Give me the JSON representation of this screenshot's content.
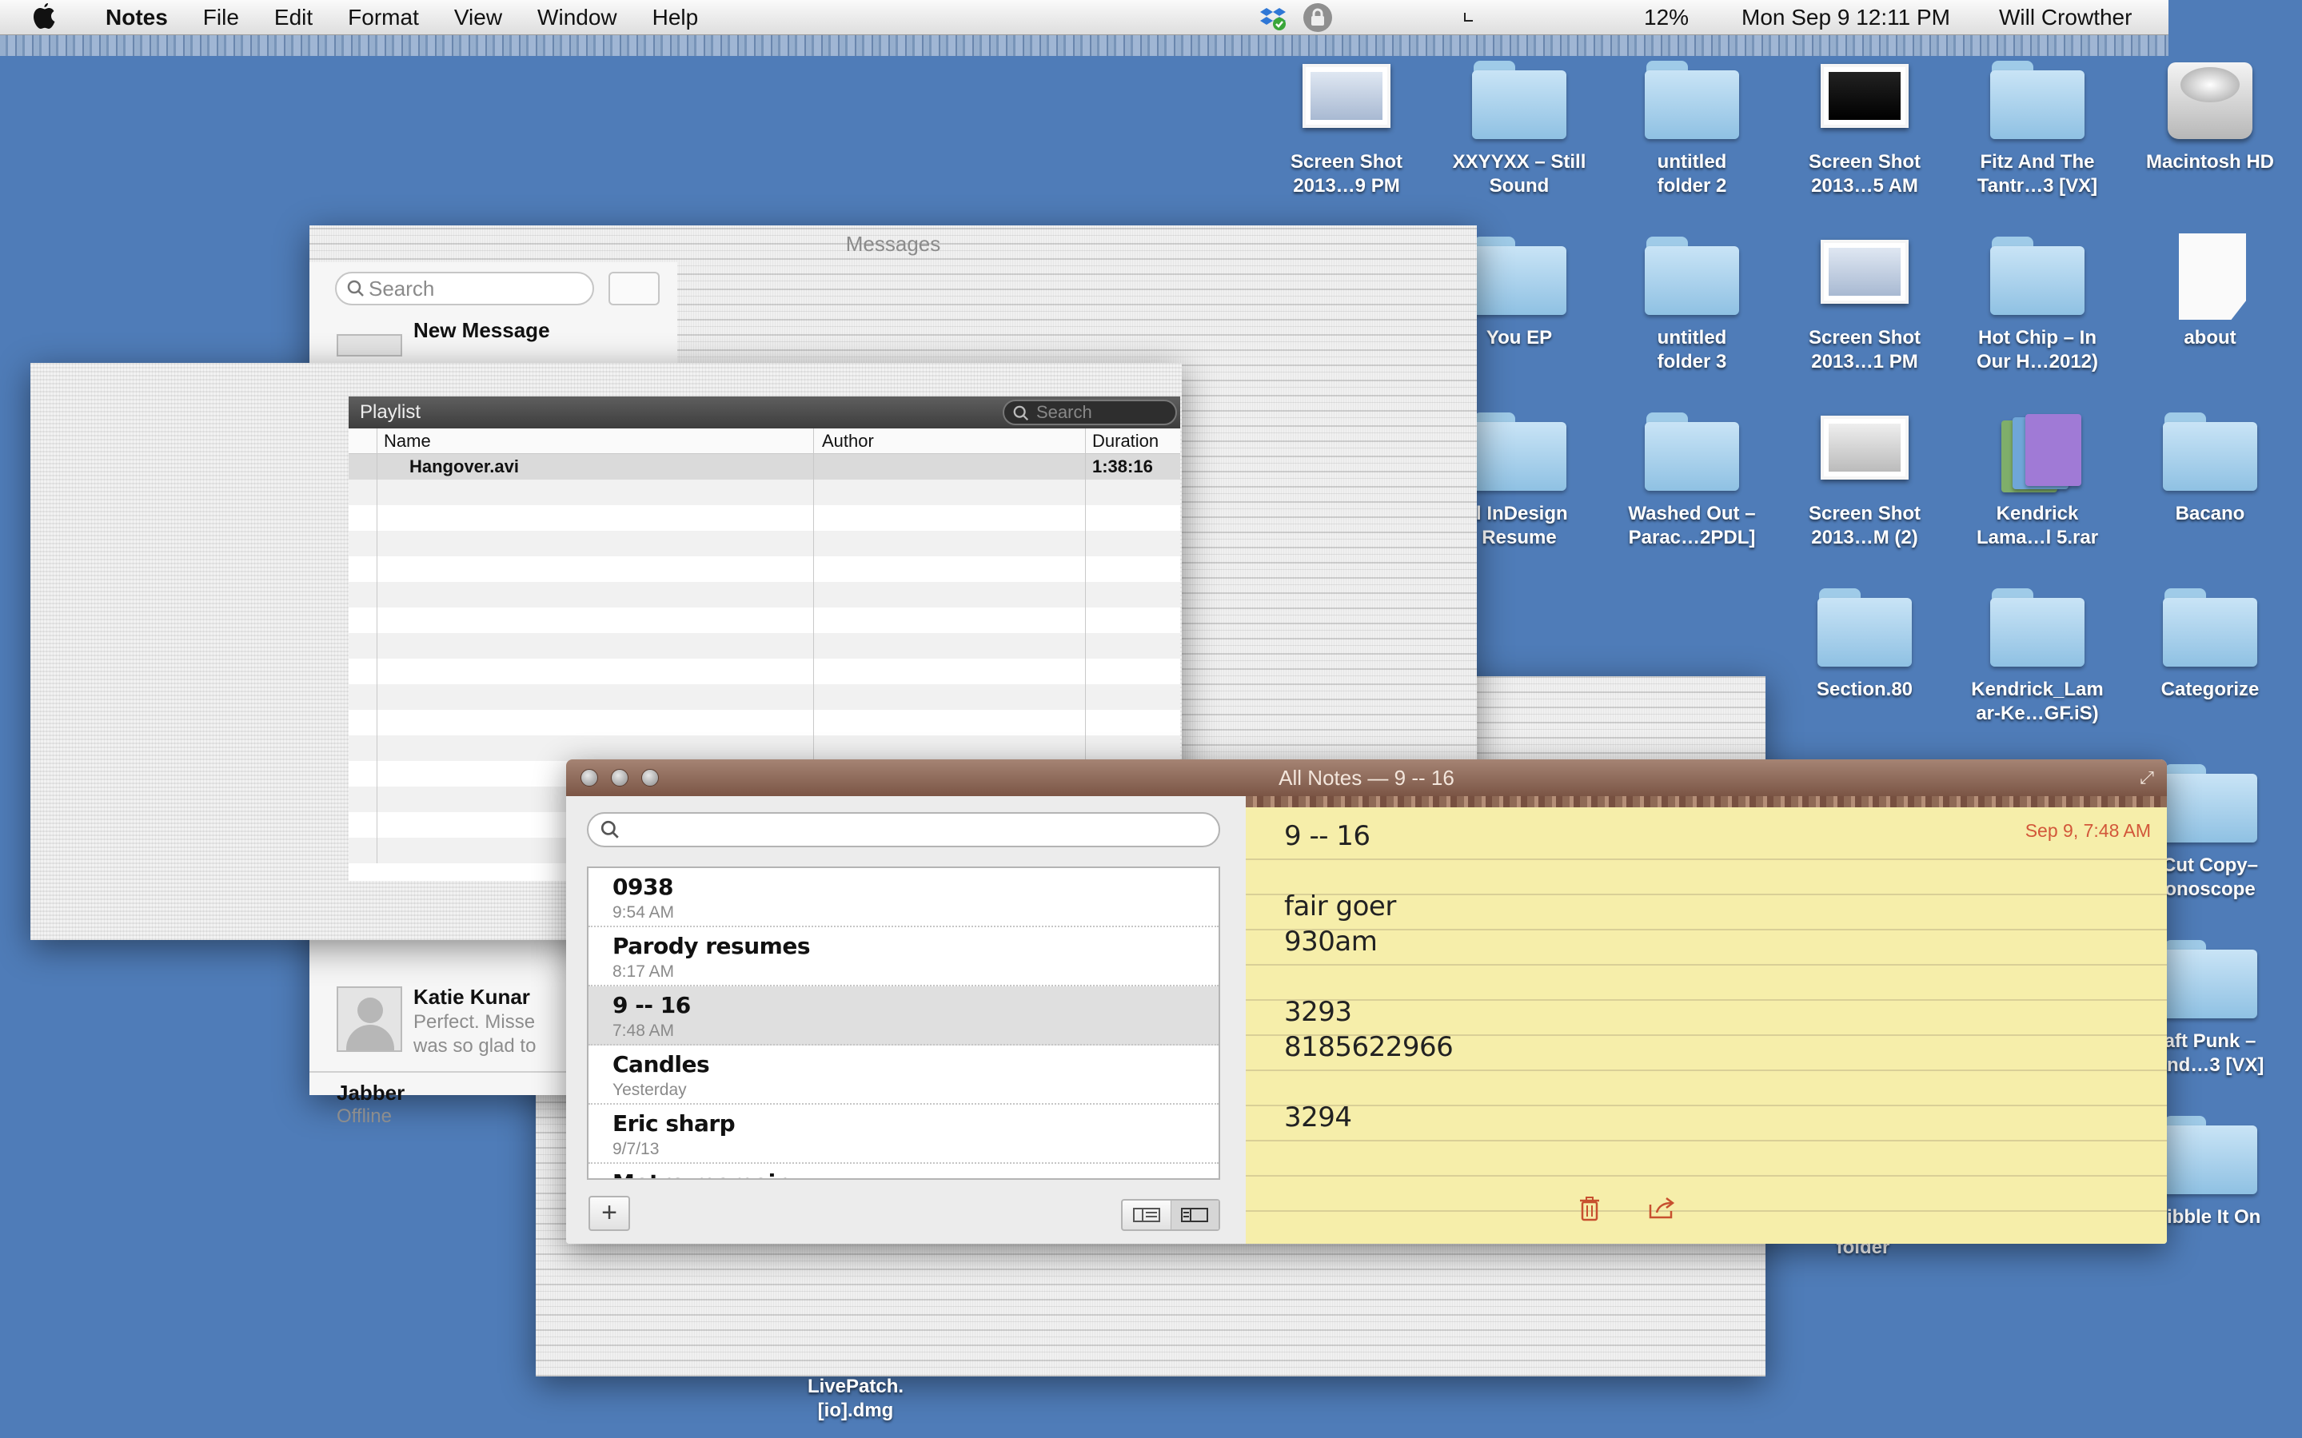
{
  "menubar": {
    "app_name": "Notes",
    "menus": [
      "File",
      "Edit",
      "Format",
      "View",
      "Window",
      "Help"
    ],
    "battery": "12%",
    "clock": "Mon Sep 9  12:11 PM",
    "user": "Will Crowther"
  },
  "desktop": {
    "icons": [
      {
        "label": "Screen Shot\n2013…9 PM",
        "kind": "screenshot"
      },
      {
        "label": "XXYYXX – Still\nSound",
        "kind": "folder"
      },
      {
        "label": "untitled\nfolder 2",
        "kind": "folder"
      },
      {
        "label": "Screen Shot\n2013…5 AM",
        "kind": "screenshot-dark"
      },
      {
        "label": "Fitz And The\nTantr…3 [VX]",
        "kind": "folder"
      },
      {
        "label": "Macintosh HD",
        "kind": "harddisk"
      },
      {
        "label": "You EP",
        "kind": "folder"
      },
      {
        "label": "untitled\nfolder 3",
        "kind": "folder"
      },
      {
        "label": "Screen Shot\n2013…1 PM",
        "kind": "screenshot"
      },
      {
        "label": "Hot Chip – In\nOur H…2012)",
        "kind": "folder"
      },
      {
        "label": "about",
        "kind": "document"
      },
      {
        "label": "ll InDesign\nResume",
        "kind": "folder"
      },
      {
        "label": "Washed Out –\nParac…2PDL]",
        "kind": "folder"
      },
      {
        "label": "Screen Shot\n2013…M (2)",
        "kind": "screenshot-gray"
      },
      {
        "label": "Kendrick\nLama…l 5.rar",
        "kind": "rar"
      },
      {
        "label": "Bacano",
        "kind": "folder"
      },
      {
        "label": "Section.80",
        "kind": "folder"
      },
      {
        "label": "Kendrick_Lam\nar-Ke…GF.iS)",
        "kind": "folder"
      },
      {
        "label": "Categorize",
        "kind": "folder"
      },
      {
        "label": "Cut Copy–\nonoscope",
        "kind": "folder"
      },
      {
        "label": "aft Punk –\nand…3 [VX]",
        "kind": "folder"
      },
      {
        "label": "ribble It On",
        "kind": "folder"
      }
    ],
    "floating_labels": {
      "folder": "folder",
      "livepatch": "LivePatch.\n[io].dmg"
    }
  },
  "messages": {
    "title": "Messages",
    "search_placeholder": "Search",
    "new_message": "New Message",
    "contact_name": "Katie Kunar",
    "contact_preview": "Perfect. Misse\nwas so glad to",
    "account_name": "Jabber",
    "account_status": "Offline"
  },
  "playlist": {
    "title": "Playlist",
    "search_placeholder": "Search",
    "columns": [
      "Name",
      "Author",
      "Duration"
    ],
    "rows": [
      {
        "name": "Hangover.avi",
        "author": "",
        "duration": "1:38:16"
      }
    ]
  },
  "notes": {
    "window_title": "All Notes — 9 -- 16",
    "list": [
      {
        "title": "0938",
        "date": "9:54 AM"
      },
      {
        "title": "Parody resumes",
        "date": "8:17 AM"
      },
      {
        "title": "9 -- 16",
        "date": "7:48 AM",
        "selected": true
      },
      {
        "title": "Candles",
        "date": "Yesterday"
      },
      {
        "title": "Eric sharp",
        "date": "9/7/13"
      },
      {
        "title": "Metro memoir",
        "date": ""
      }
    ],
    "add_label": "+",
    "current": {
      "date": "Sep 9, 7:48 AM",
      "lines": [
        "9 -- 16",
        "",
        "fair goer",
        "930am",
        "",
        "3293",
        "8185622966",
        "",
        "3294"
      ]
    }
  },
  "colors": {
    "desktop": "#4f7cb8",
    "notes_title": "#8d6757",
    "paper": "#f6eeaa",
    "paper_date": "#d2573a"
  }
}
